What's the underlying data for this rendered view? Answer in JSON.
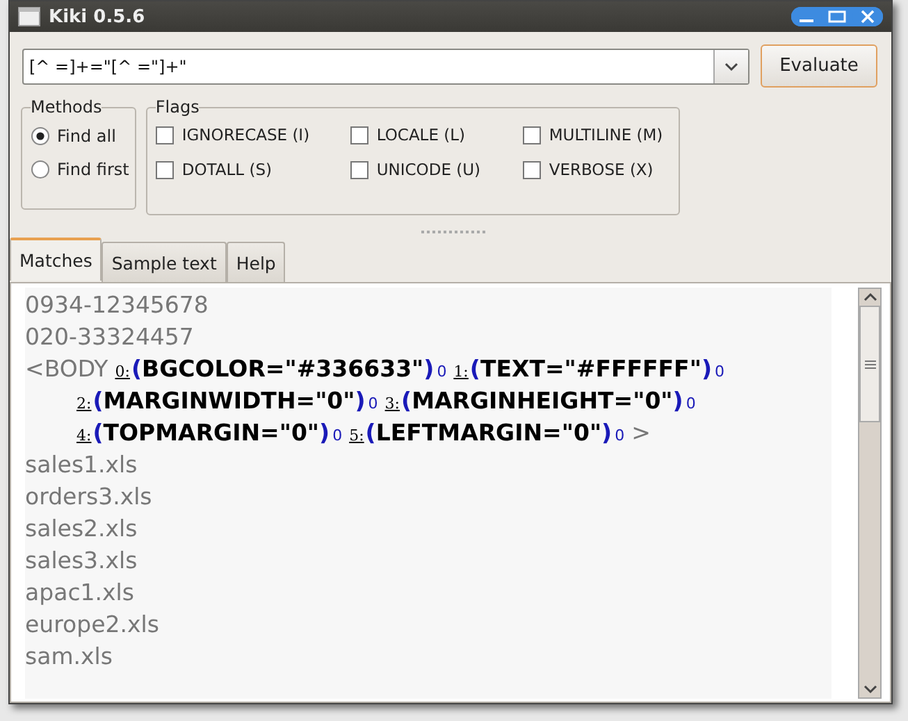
{
  "window": {
    "title": "Kiki 0.5.6"
  },
  "regex": {
    "value": "[^ =]+=\"[^ =\"]+\""
  },
  "evaluate_button": "Evaluate",
  "methods": {
    "title": "Methods",
    "options": [
      {
        "label": "Find all",
        "selected": true
      },
      {
        "label": "Find first",
        "selected": false
      }
    ]
  },
  "flags": {
    "title": "Flags",
    "items": [
      {
        "label": "IGNORECASE (I)",
        "checked": false
      },
      {
        "label": "LOCALE (L)",
        "checked": false
      },
      {
        "label": "MULTILINE (M)",
        "checked": false
      },
      {
        "label": "DOTALL (S)",
        "checked": false
      },
      {
        "label": "UNICODE (U)",
        "checked": false
      },
      {
        "label": "VERBOSE (X)",
        "checked": false
      }
    ]
  },
  "tabs": [
    {
      "label": "Matches",
      "selected": true
    },
    {
      "label": "Sample text",
      "selected": false
    },
    {
      "label": "Help",
      "selected": false
    }
  ],
  "matches": {
    "lines": [
      {
        "segments": [
          {
            "kind": "text",
            "text": "0934-12345678"
          }
        ]
      },
      {
        "segments": [
          {
            "kind": "text",
            "text": "020-33324457"
          }
        ]
      },
      {
        "segments": [
          {
            "kind": "text",
            "text": "<BODY"
          },
          {
            "kind": "group",
            "label": "0:",
            "open": "(",
            "text": "BGCOLOR=\"#336633\"",
            "close": ")",
            "count": "0"
          },
          {
            "kind": "group",
            "label": "1:",
            "open": "(",
            "text": "TEXT=\"#FFFFFF\"",
            "close": ")",
            "count": "0"
          }
        ]
      },
      {
        "continued": true,
        "segments": [
          {
            "kind": "group",
            "label": "2:",
            "open": "(",
            "text": "MARGINWIDTH=\"0\"",
            "close": ")",
            "count": "0"
          },
          {
            "kind": "group",
            "label": "3:",
            "open": "(",
            "text": "MARGINHEIGHT=\"0\"",
            "close": ")",
            "count": "0"
          }
        ]
      },
      {
        "continued": true,
        "segments": [
          {
            "kind": "group",
            "label": "4:",
            "open": "(",
            "text": "TOPMARGIN=\"0\"",
            "close": ")",
            "count": "0"
          },
          {
            "kind": "group",
            "label": "5:",
            "open": "(",
            "text": "LEFTMARGIN=\"0\"",
            "close": ")",
            "count": "0"
          },
          {
            "kind": "text",
            "text": ">"
          }
        ]
      },
      {
        "segments": [
          {
            "kind": "text",
            "text": "sales1.xls"
          }
        ]
      },
      {
        "segments": [
          {
            "kind": "text",
            "text": "orders3.xls"
          }
        ]
      },
      {
        "segments": [
          {
            "kind": "text",
            "text": "sales2.xls"
          }
        ]
      },
      {
        "segments": [
          {
            "kind": "text",
            "text": "sales3.xls"
          }
        ]
      },
      {
        "segments": [
          {
            "kind": "text",
            "text": "apac1.xls"
          }
        ]
      },
      {
        "segments": [
          {
            "kind": "text",
            "text": "europe2.xls"
          }
        ]
      },
      {
        "segments": [
          {
            "kind": "text",
            "text": "sam.xls"
          }
        ]
      }
    ]
  }
}
